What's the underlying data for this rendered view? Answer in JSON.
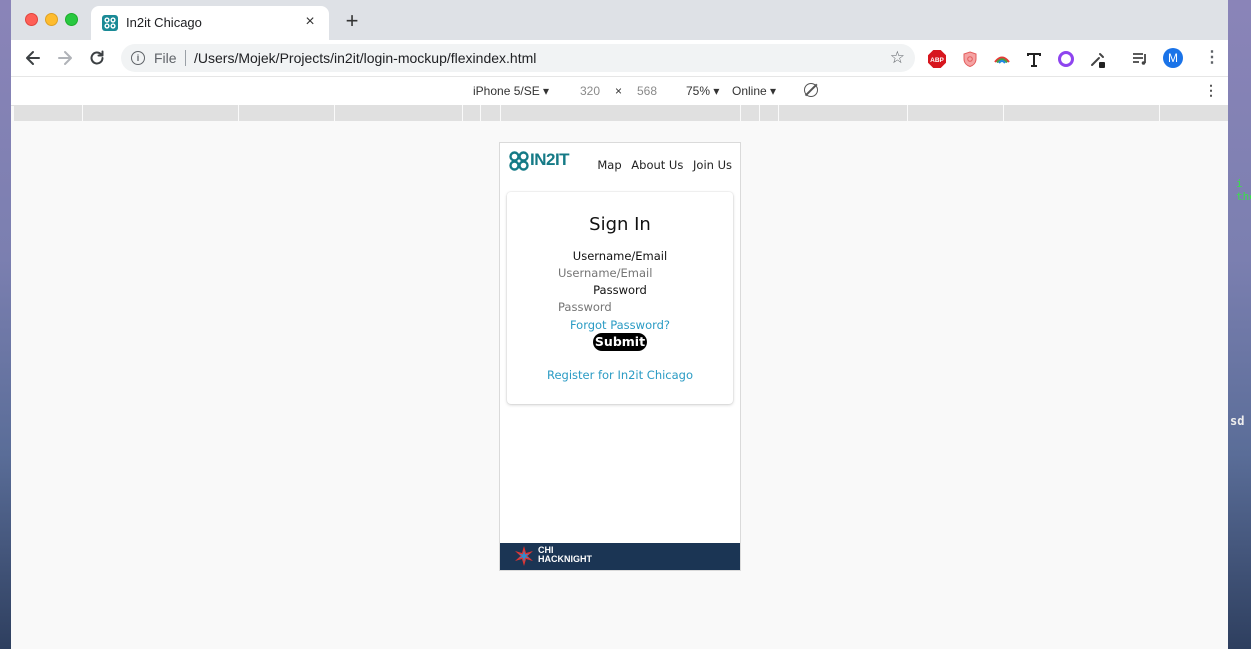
{
  "browser": {
    "tab_title": "In2it Chicago",
    "new_tab_symbol": "+",
    "close_symbol": "×",
    "address_scheme_label": "File",
    "url": "/Users/Mojek/Projects/in2it/login-mockup/flexindex.html",
    "profile_initial": "M",
    "abp_label": "ABP"
  },
  "device_toolbar": {
    "device": "iPhone 5/SE",
    "width": "320",
    "times": "×",
    "height": "568",
    "zoom": "75%",
    "network": "Online"
  },
  "site": {
    "logo_text": "IN2IT",
    "nav": [
      "Map",
      "About Us",
      "Join Us"
    ],
    "signin": {
      "title": "Sign In",
      "username_label": "Username/Email",
      "username_placeholder": "Username/Email",
      "password_label": "Password",
      "password_placeholder": "Password",
      "forgot": "Forgot Password?",
      "submit": "Submit",
      "register": "Register for In2it Chicago"
    },
    "footer": {
      "line1": "CHI",
      "line2": "HACKNIGHT"
    }
  },
  "background": {
    "fragment1": "i the",
    "fragment2": "sd"
  },
  "colors": {
    "brand_teal": "#157a86",
    "link_blue": "#2a9bc4",
    "footer_navy": "#1b3554",
    "placeholder": "#8fd2e8"
  }
}
